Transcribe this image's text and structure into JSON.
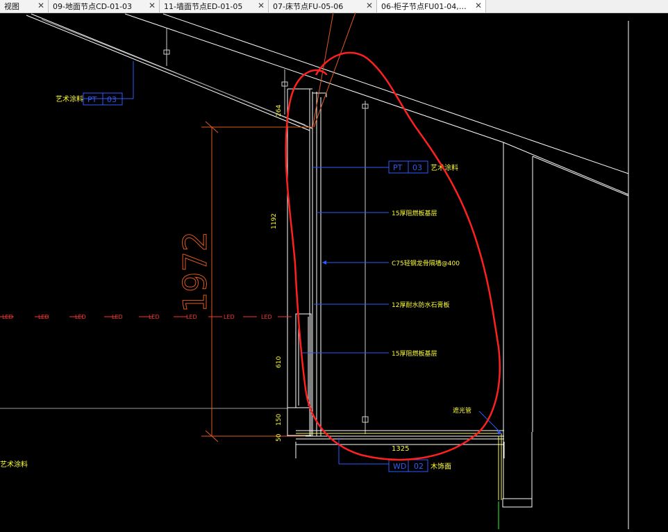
{
  "tabs": [
    {
      "label": "视图",
      "active": false
    },
    {
      "label": "09-地面节点CD-01-03",
      "active": false
    },
    {
      "label": "11-墙面节点ED-01-05",
      "active": false
    },
    {
      "label": "07-床节点FU-05-06",
      "active": false
    },
    {
      "label": "06-柜子节点FU01-04,…",
      "active": true
    }
  ],
  "close_glyph": "✕",
  "drawing": {
    "label_art_paint_left": "艺术涂料",
    "tag_pt_left": "PT",
    "tag_03_left": "03",
    "tag_pt_right": "PT",
    "tag_03_right": "03",
    "label_art_paint_right": "艺术涂料",
    "note_1": "15厚阻燃板基层",
    "note_2": "C75轻钢龙骨隔墙@400",
    "note_3": "12厚耐水防水石膏板",
    "note_4": "15厚阻燃板基层",
    "note_lighttrough": "遮光管",
    "dim_1192": "1192",
    "dim_610": "610",
    "dim_150": "150",
    "dim_50": "50",
    "dim_1325": "1325",
    "dim_big": "1972",
    "dim_small_top": "264",
    "led_label": "LED",
    "tag_wd": "WD",
    "tag_02": "02",
    "label_wood_finish": "木饰面",
    "label_art_paint_bottom": "艺术涂料"
  },
  "colors": {
    "background": "#000000",
    "line_white": "#ffffff",
    "dim_orange": "#e05a20",
    "leader_blue": "#2e5cff",
    "text_yellow": "#ffff33",
    "markup_red": "#ff2020",
    "grey": "#9a9a9a",
    "green": "#2aff2a"
  }
}
